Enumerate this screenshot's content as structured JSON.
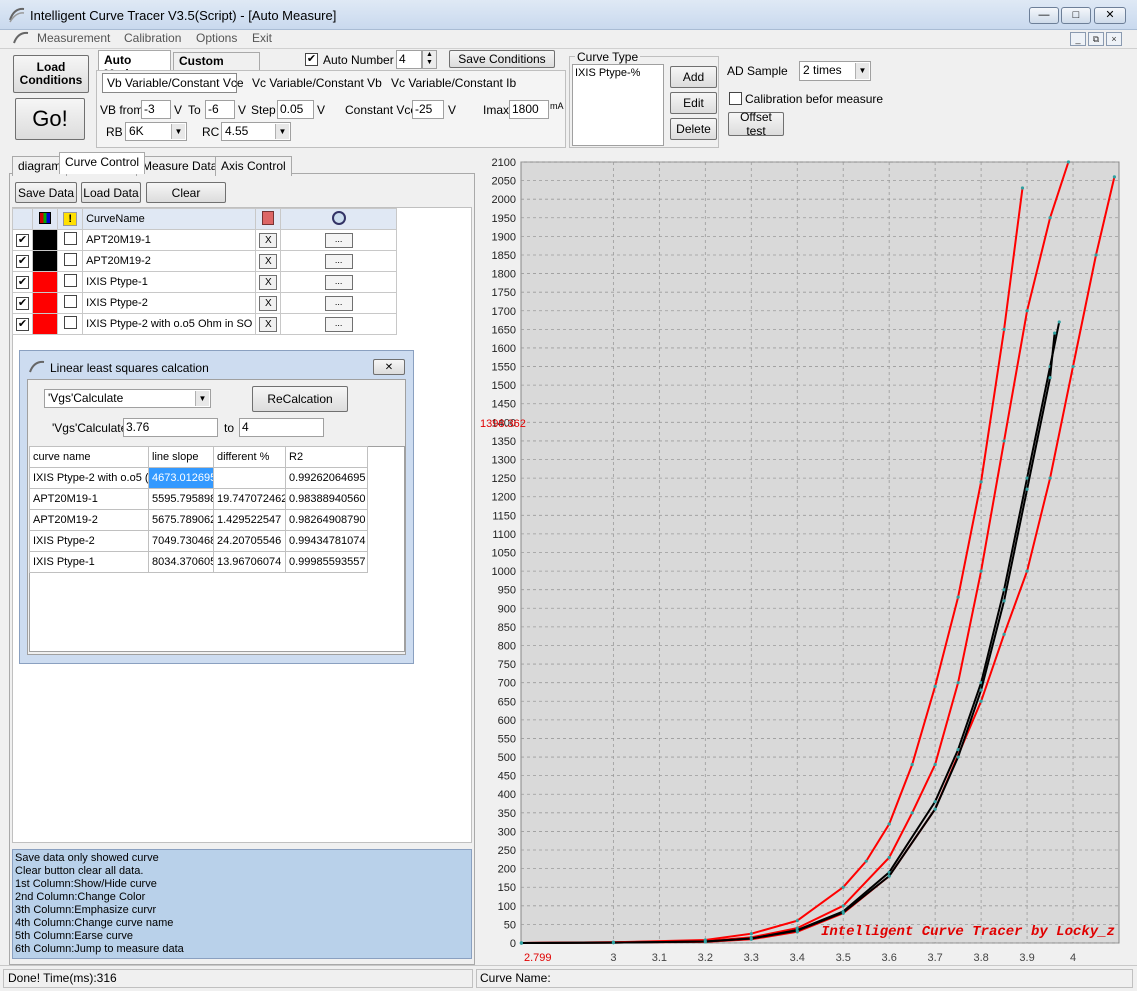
{
  "window": {
    "title": "Intelligent Curve Tracer V3.5(Script) - [Auto Measure]",
    "min": "—",
    "max": "□",
    "close": "✕"
  },
  "menu": [
    "Measurement",
    "Calibration",
    "Options",
    "Exit"
  ],
  "mdi": {
    "min": "_",
    "restore": "⧉",
    "close": "×"
  },
  "toolbar": {
    "load_conditions": "Load Conditions",
    "go": "Go!",
    "auto_mode": "Auto Mode",
    "custom_mode": "Custom Mode",
    "auto_number_label": "Auto Number",
    "auto_number_checked": true,
    "auto_number_value": "4",
    "save_conditions": "Save Conditions",
    "mode_tabs": [
      "Vb Variable/Constant Vce",
      "Vc Variable/Constant Vb",
      "Vc Variable/Constant Ib"
    ],
    "vb_from_label": "VB from",
    "vb_from": "-3",
    "v1": "V",
    "to_label": "To",
    "to_value": "-6",
    "v2": "V",
    "step_label": "Step",
    "step_value": "0.05",
    "v3": "V",
    "constant_vce_label": "Constant Vce",
    "constant_vce": "-25",
    "v4": "V",
    "imax_label": "Imax",
    "imax_value": "1800",
    "imax_unit": "mA",
    "rb_label": "RB",
    "rb_value": "6K",
    "rc_label": "RC",
    "rc_value": "4.55"
  },
  "curve_type": {
    "title": "Curve Type",
    "items": [
      "IXIS Ptype-%"
    ],
    "add": "Add",
    "edit": "Edit",
    "delete": "Delete"
  },
  "ad": {
    "label": "AD Sample",
    "value": "2 times",
    "calib_label": "Calibration befor measure",
    "calib_checked": false,
    "offset": "Offset test"
  },
  "tabs": [
    "diagram",
    "Curve Control",
    "Measure Data",
    "Axis Control"
  ],
  "curve_control": {
    "save_data": "Save Data",
    "load_data": "Load Data",
    "clear": "Clear",
    "header_name": "CurveName",
    "rows": [
      {
        "show": true,
        "color": "#000000",
        "emph": false,
        "name": "APT20M19-1",
        "x": "X",
        "dots": "..."
      },
      {
        "show": true,
        "color": "#000000",
        "emph": false,
        "name": "APT20M19-2",
        "x": "X",
        "dots": "..."
      },
      {
        "show": true,
        "color": "#ff0000",
        "emph": false,
        "name": "IXIS Ptype-1",
        "x": "X",
        "dots": "..."
      },
      {
        "show": true,
        "color": "#ff0000",
        "emph": false,
        "name": "IXIS Ptype-2",
        "x": "X",
        "dots": "..."
      },
      {
        "show": true,
        "color": "#ff0000",
        "emph": false,
        "name": "IXIS Ptype-2 with o.o5 Ohm in SO",
        "x": "X",
        "dots": "..."
      }
    ]
  },
  "ls_dialog": {
    "title": "Linear least squares calcation",
    "close": "✕",
    "select_value": "'Vgs'Calculate",
    "recalc": "ReCalcation",
    "calc_label": "'Vgs'Calculate",
    "from": "3.76",
    "to_label": "to",
    "to": "4",
    "headers": [
      "curve name",
      "line slope",
      "different %",
      "R2"
    ],
    "rows": [
      [
        "IXIS Ptype-2 with o.o5 (",
        "4673.012695",
        "",
        "0.99262064695"
      ],
      [
        "APT20M19-1",
        "5595.795898",
        "19.747072462",
        "0.98388940560"
      ],
      [
        "APT20M19-2",
        "5675.789062",
        "1.429522547",
        "0.98264908790"
      ],
      [
        "IXIS Ptype-2",
        "7049.730468",
        "24.20705546",
        "0.99434781074"
      ],
      [
        "IXIS Ptype-1",
        "8034.370605",
        "13.96706074",
        "0.99985593557"
      ]
    ]
  },
  "info_lines": [
    " Save data only showed curve",
    "  Clear button clear all data.",
    "1st Column:Show/Hide curve",
    "2nd Column:Change Color",
    "3th Column:Emphasize curvr",
    "4th Column:Change curve name",
    "5th Column:Earse curve",
    "6th Column:Jump to measure data"
  ],
  "status": {
    "left": "Done!  Time(ms):316",
    "right": "Curve Name:"
  },
  "chart_data": {
    "type": "line",
    "xlim": [
      2.799,
      4.1
    ],
    "ylim": [
      0,
      2100
    ],
    "x_ticks": [
      3,
      3.1,
      3.2,
      3.3,
      3.4,
      3.5,
      3.6,
      3.7,
      3.8,
      3.9,
      4
    ],
    "y_ticks": [
      0,
      50,
      100,
      150,
      200,
      250,
      300,
      350,
      400,
      450,
      500,
      550,
      600,
      650,
      700,
      750,
      800,
      850,
      900,
      950,
      1000,
      1050,
      1100,
      1150,
      1200,
      1250,
      1300,
      1350,
      1400,
      1450,
      1500,
      1550,
      1600,
      1650,
      1700,
      1750,
      1800,
      1850,
      1900,
      1950,
      2000,
      2050,
      2100
    ],
    "x_min_label": "2.799",
    "cursor_label": "1398.362",
    "watermark": "Intelligent Curve Tracer by Locky_z",
    "grid": true,
    "series": [
      {
        "color": "#ff0000",
        "x": [
          2.8,
          3.0,
          3.2,
          3.3,
          3.4,
          3.5,
          3.55,
          3.6,
          3.65,
          3.7,
          3.75,
          3.8,
          3.85,
          3.89
        ],
        "y": [
          0,
          2,
          8,
          25,
          60,
          150,
          220,
          320,
          480,
          690,
          930,
          1240,
          1650,
          2030
        ]
      },
      {
        "color": "#ff0000",
        "x": [
          2.8,
          3.0,
          3.2,
          3.3,
          3.4,
          3.5,
          3.6,
          3.65,
          3.7,
          3.75,
          3.8,
          3.85,
          3.9,
          3.95,
          3.99
        ],
        "y": [
          0,
          2,
          5,
          15,
          40,
          100,
          230,
          350,
          480,
          700,
          1000,
          1350,
          1700,
          1950,
          2100
        ]
      },
      {
        "color": "#ff0000",
        "x": [
          2.8,
          3.0,
          3.2,
          3.3,
          3.4,
          3.5,
          3.6,
          3.7,
          3.8,
          3.85,
          3.9,
          3.95,
          4.0,
          4.05,
          4.09
        ],
        "y": [
          0,
          1,
          3,
          10,
          30,
          80,
          180,
          360,
          650,
          830,
          1000,
          1250,
          1550,
          1850,
          2060
        ]
      },
      {
        "color": "#000000",
        "x": [
          2.8,
          3.0,
          3.2,
          3.3,
          3.4,
          3.5,
          3.6,
          3.7,
          3.75,
          3.8,
          3.85,
          3.9,
          3.95,
          3.97
        ],
        "y": [
          0,
          1,
          4,
          12,
          35,
          85,
          190,
          380,
          520,
          700,
          950,
          1250,
          1550,
          1670
        ]
      },
      {
        "color": "#000000",
        "x": [
          2.8,
          3.0,
          3.2,
          3.3,
          3.4,
          3.5,
          3.6,
          3.7,
          3.75,
          3.8,
          3.85,
          3.9,
          3.95,
          3.96
        ],
        "y": [
          0,
          1,
          4,
          12,
          33,
          82,
          180,
          360,
          500,
          680,
          920,
          1220,
          1520,
          1640
        ]
      }
    ]
  }
}
